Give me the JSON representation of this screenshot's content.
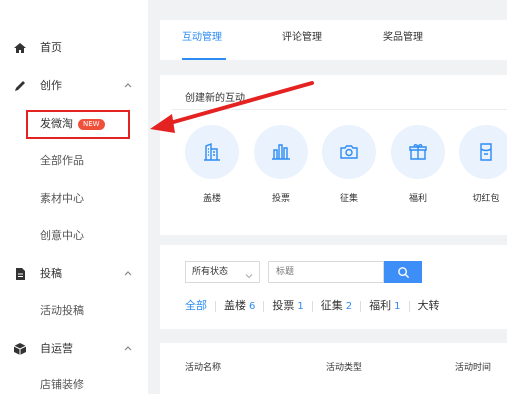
{
  "sidebar": {
    "items": [
      {
        "label": "首页",
        "icon": "home-icon"
      },
      {
        "label": "创作",
        "icon": "pencil-icon",
        "expanded": true
      },
      {
        "label": "发微淘",
        "badge": "NEW",
        "sub": true
      },
      {
        "label": "全部作品",
        "sub": true
      },
      {
        "label": "素材中心",
        "sub": true
      },
      {
        "label": "创意中心",
        "sub": true
      },
      {
        "label": "投稿",
        "icon": "document-icon",
        "expanded": true
      },
      {
        "label": "活动投稿",
        "sub": true
      },
      {
        "label": "自运营",
        "icon": "cube-icon",
        "expanded": true
      },
      {
        "label": "店铺装修",
        "sub": true
      }
    ]
  },
  "tabs": [
    {
      "label": "互动管理",
      "active": true
    },
    {
      "label": "评论管理"
    },
    {
      "label": "奖品管理"
    }
  ],
  "create": {
    "title": "创建新的互动",
    "actions": [
      {
        "label": "盖楼",
        "icon": "building-icon"
      },
      {
        "label": "投票",
        "icon": "bar-chart-icon"
      },
      {
        "label": "征集",
        "icon": "camera-icon"
      },
      {
        "label": "福利",
        "icon": "gift-icon"
      },
      {
        "label": "切红包",
        "icon": "red-packet-icon"
      }
    ]
  },
  "filter": {
    "status_label": "所有状态",
    "search_placeholder": "标题",
    "categories": [
      {
        "label": "全部",
        "count": ""
      },
      {
        "label": "盖楼",
        "count": "6"
      },
      {
        "label": "投票",
        "count": "1"
      },
      {
        "label": "征集",
        "count": "2"
      },
      {
        "label": "福利",
        "count": "1"
      },
      {
        "label": "大转",
        "count": ""
      }
    ]
  },
  "table": {
    "columns": [
      "活动名称",
      "活动类型",
      "活动时间"
    ]
  },
  "colors": {
    "accent": "#2c8cf4",
    "highlight": "#e52222",
    "badge": "#f0503a",
    "icon_bg": "#e9f2fd"
  }
}
